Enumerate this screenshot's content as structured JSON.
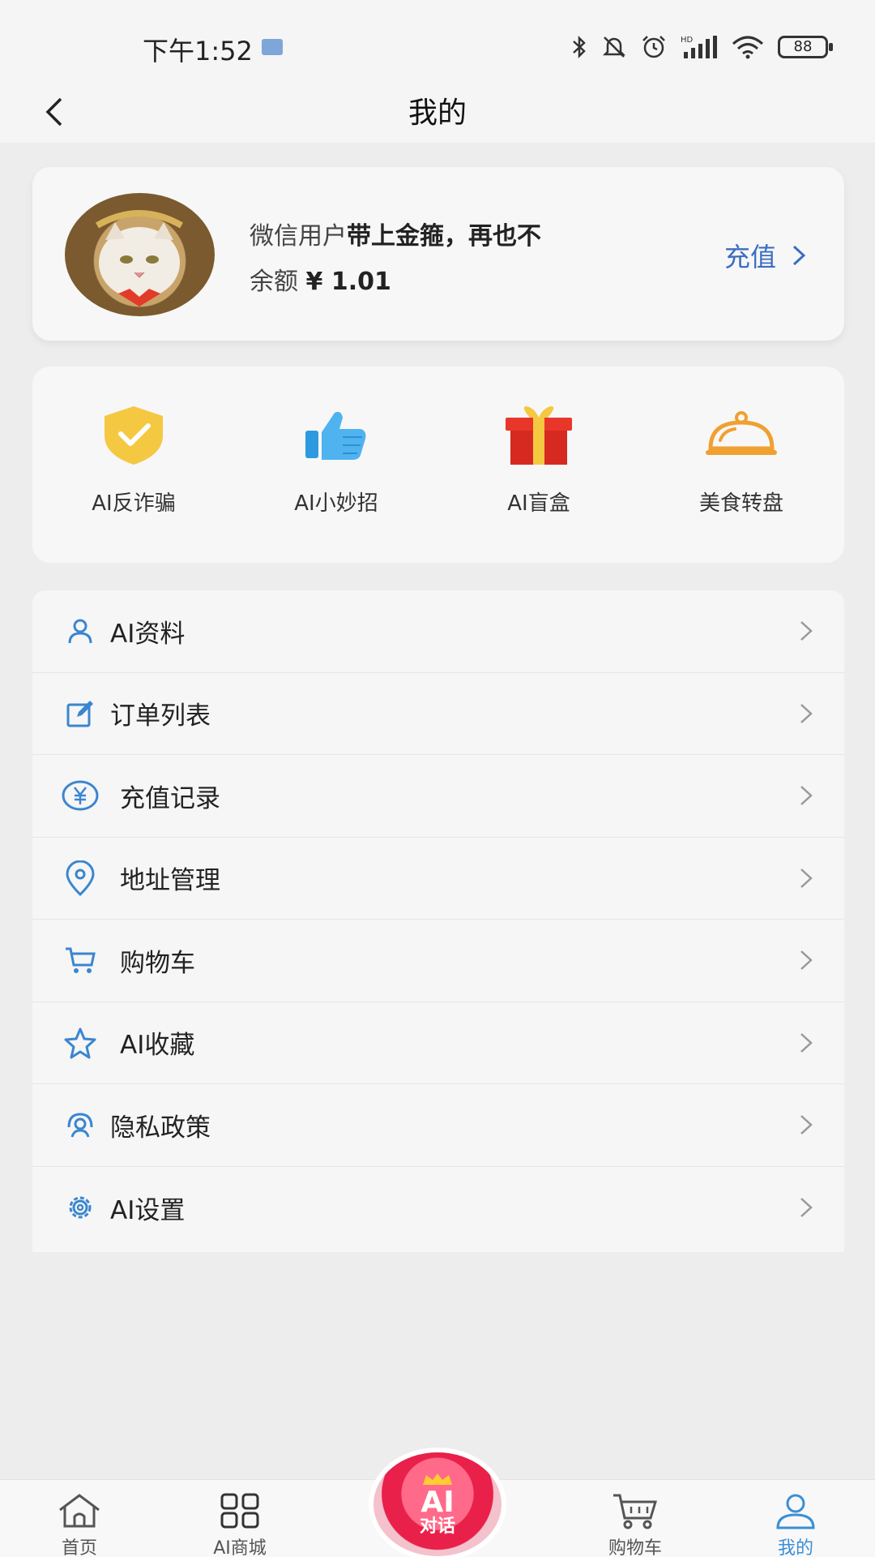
{
  "status_bar": {
    "time": "下午1:52",
    "battery": "88"
  },
  "header": {
    "title": "我的"
  },
  "profile": {
    "user_prefix": "微信用户",
    "user_name": "带上金箍，再也不",
    "balance_label": "余额",
    "balance_value": "¥ 1.01",
    "recharge_label": "充值"
  },
  "tools": [
    {
      "label": "AI反诈骗",
      "icon": "shield-check-icon"
    },
    {
      "label": "AI小妙招",
      "icon": "thumbs-up-icon"
    },
    {
      "label": "AI盲盒",
      "icon": "gift-box-icon"
    },
    {
      "label": "美食转盘",
      "icon": "food-cloche-icon"
    }
  ],
  "menu": [
    {
      "label": "AI资料",
      "icon": "user-icon"
    },
    {
      "label": "订单列表",
      "icon": "edit-icon"
    },
    {
      "label": "充值记录",
      "icon": "yen-circle-icon"
    },
    {
      "label": "地址管理",
      "icon": "location-pin-icon"
    },
    {
      "label": "购物车",
      "icon": "cart-icon"
    },
    {
      "label": "AI收藏",
      "icon": "star-icon"
    },
    {
      "label": "隐私政策",
      "icon": "privacy-icon"
    },
    {
      "label": "AI设置",
      "icon": "gear-icon"
    }
  ],
  "tabbar": {
    "home": "首页",
    "mall": "AI商城",
    "chat_top": "AI",
    "chat_bottom": "对话",
    "cart": "购物车",
    "mine": "我的"
  },
  "colors": {
    "accent": "#3b6ec2",
    "active_tab": "#3a8fd6"
  }
}
